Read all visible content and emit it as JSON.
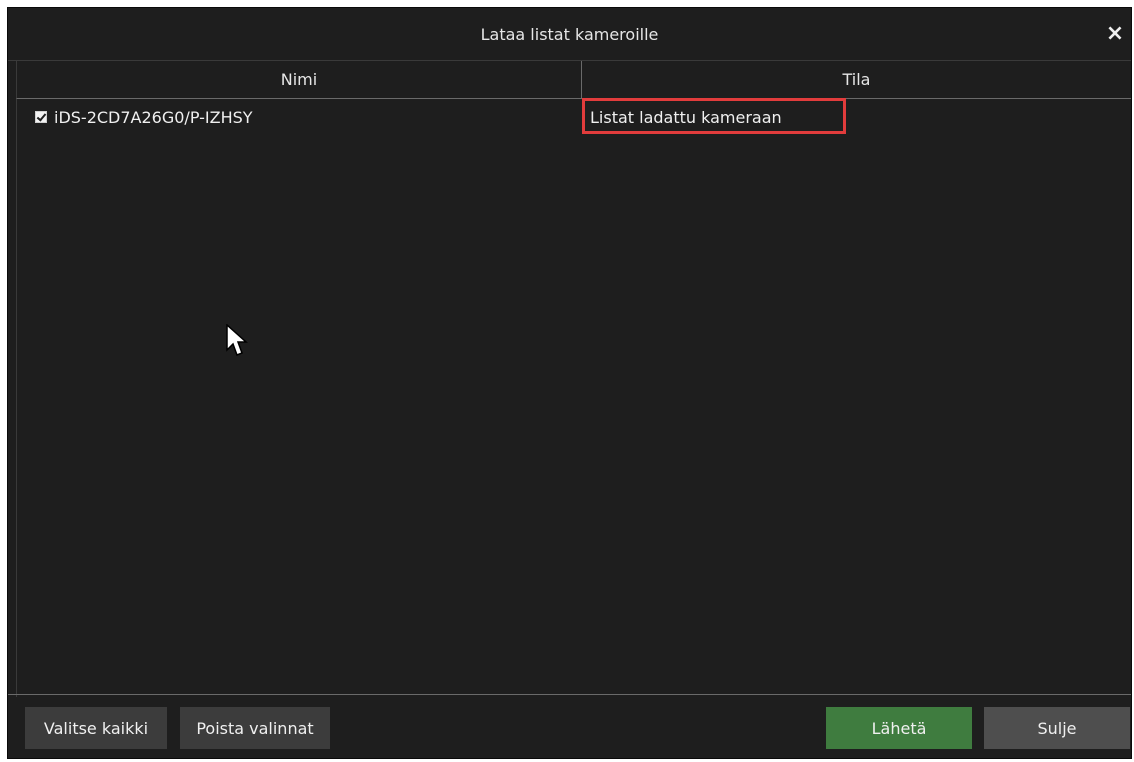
{
  "dialog": {
    "title": "Lataa listat kameroille",
    "close_glyph": "×"
  },
  "table": {
    "columns": [
      "Nimi",
      "Tila"
    ],
    "rows": [
      {
        "checked": true,
        "name": "iDS-2CD7A26G0/P-IZHSY",
        "status": "Listat ladattu kameraan",
        "status_highlighted": true
      }
    ]
  },
  "buttons": {
    "select_all": "Valitse kaikki",
    "clear_selection": "Poista valinnat",
    "send": "Lähetä",
    "close": "Sulje"
  },
  "colors": {
    "background": "#1e1e1e",
    "send_button": "#3f7c3f",
    "highlight": "#e23c3c"
  }
}
